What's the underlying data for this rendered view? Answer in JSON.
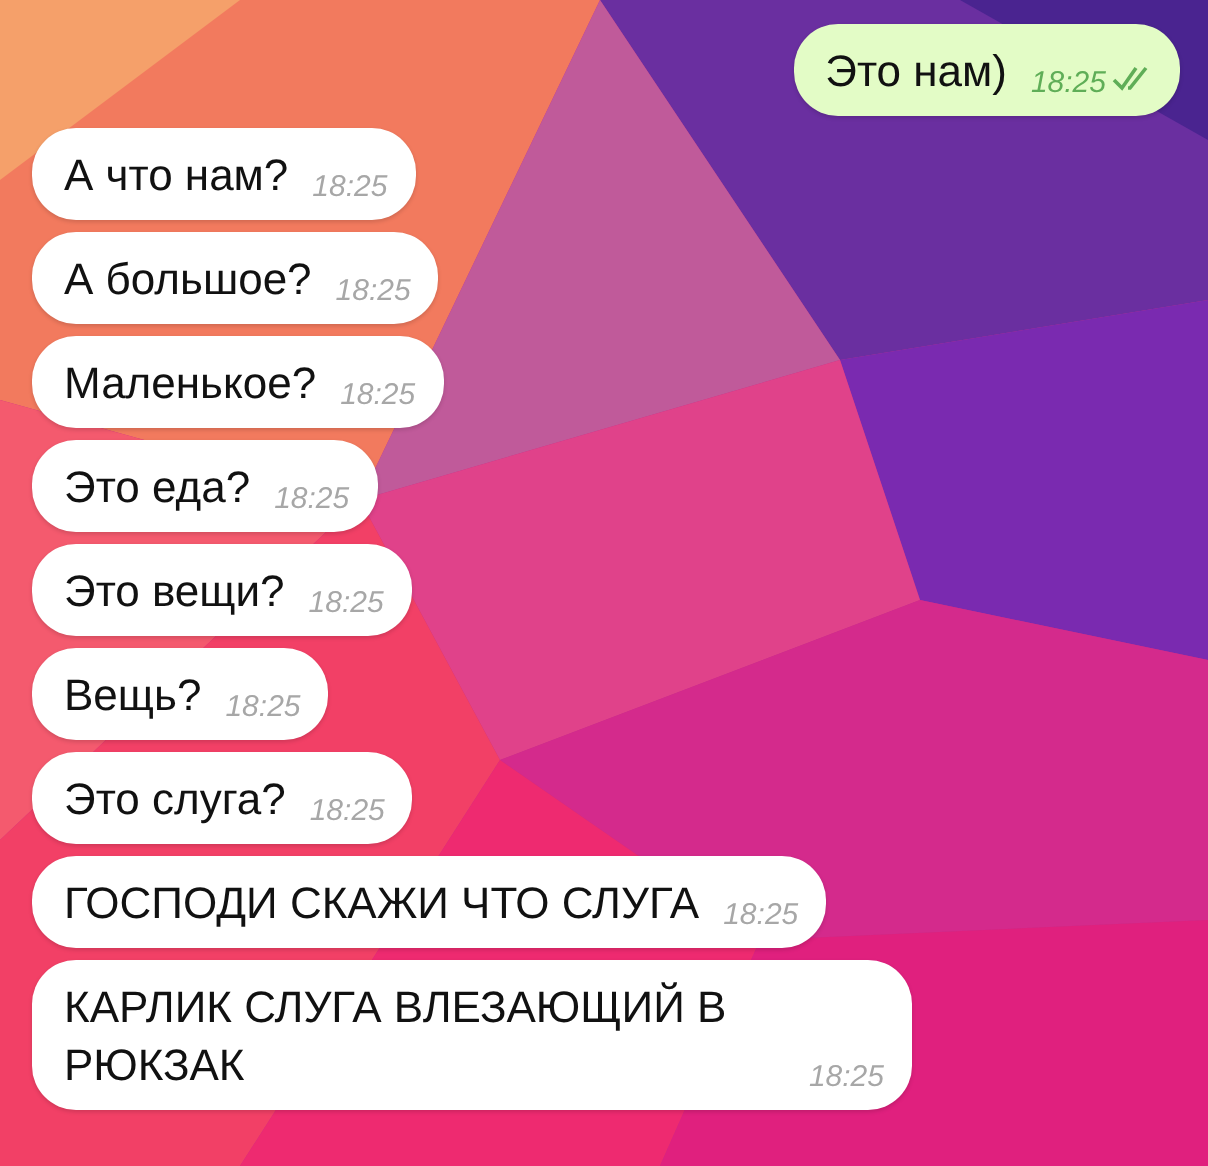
{
  "messages": [
    {
      "kind": "outgoing",
      "text": "Это нам)",
      "time": "18:25",
      "read": true
    },
    {
      "kind": "incoming",
      "text": "А что нам?",
      "time": "18:25"
    },
    {
      "kind": "incoming",
      "text": "А большое?",
      "time": "18:25"
    },
    {
      "kind": "incoming",
      "text": "Маленькое?",
      "time": "18:25"
    },
    {
      "kind": "incoming",
      "text": "Это еда?",
      "time": "18:25"
    },
    {
      "kind": "incoming",
      "text": "Это вещи?",
      "time": "18:25"
    },
    {
      "kind": "incoming",
      "text": "Вещь?",
      "time": "18:25"
    },
    {
      "kind": "incoming",
      "text": "Это слуга?",
      "time": "18:25"
    },
    {
      "kind": "incoming",
      "text": "ГОСПОДИ СКАЖИ ЧТО СЛУГА",
      "time": "18:25"
    },
    {
      "kind": "incoming",
      "text": "КАРЛИК СЛУГА ВЛЕЗАЮЩИЙ В РЮКЗАК",
      "time": "18:25"
    }
  ]
}
